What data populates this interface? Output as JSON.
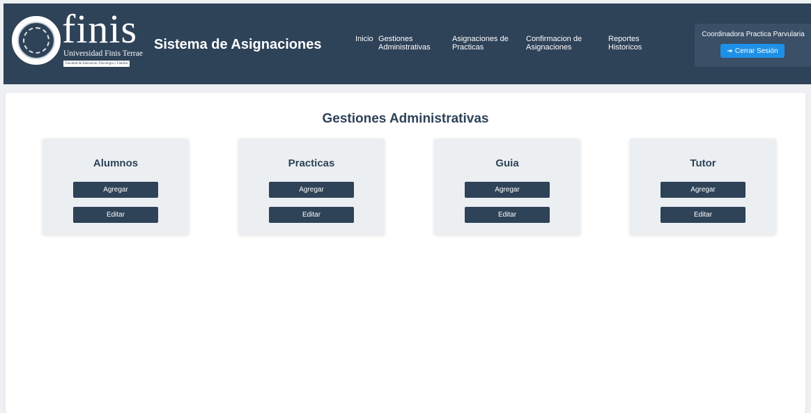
{
  "header": {
    "logo_word": "finis",
    "logo_sub": "Universidad Finis Terrae",
    "logo_faculty": "Facultad de Educación, Psicología y Familia",
    "app_title": "Sistema de Asignaciones",
    "nav": [
      {
        "line1": "Inicio",
        "line2": ""
      },
      {
        "line1": "Gestiones",
        "line2": "Administrativas"
      },
      {
        "line1": "Asignaciones de",
        "line2": "Practicas"
      },
      {
        "line1": "Confirmacion de",
        "line2": "Asignaciones"
      },
      {
        "line1": "Reportes",
        "line2": "Historicos"
      }
    ],
    "user_role": "Coordinadora Practica Parvularia",
    "logout_label": "Cerrar Sesión",
    "logout_icon": "sign-out-icon"
  },
  "main": {
    "title": "Gestiones Administrativas",
    "sections": [
      {
        "title": "Alumnos",
        "add_label": "Agregar",
        "edit_label": "Editar"
      },
      {
        "title": "Practicas",
        "add_label": "Agregar",
        "edit_label": "Editar"
      },
      {
        "title": "Guia",
        "add_label": "Agregar",
        "edit_label": "Editar"
      },
      {
        "title": "Tutor",
        "add_label": "Agregar",
        "edit_label": "Editar"
      }
    ]
  },
  "colors": {
    "header_bg": "#2e4258",
    "accent_button": "#1e90e8",
    "page_bg": "#eef0f3",
    "card_bg": "#eceff2"
  }
}
